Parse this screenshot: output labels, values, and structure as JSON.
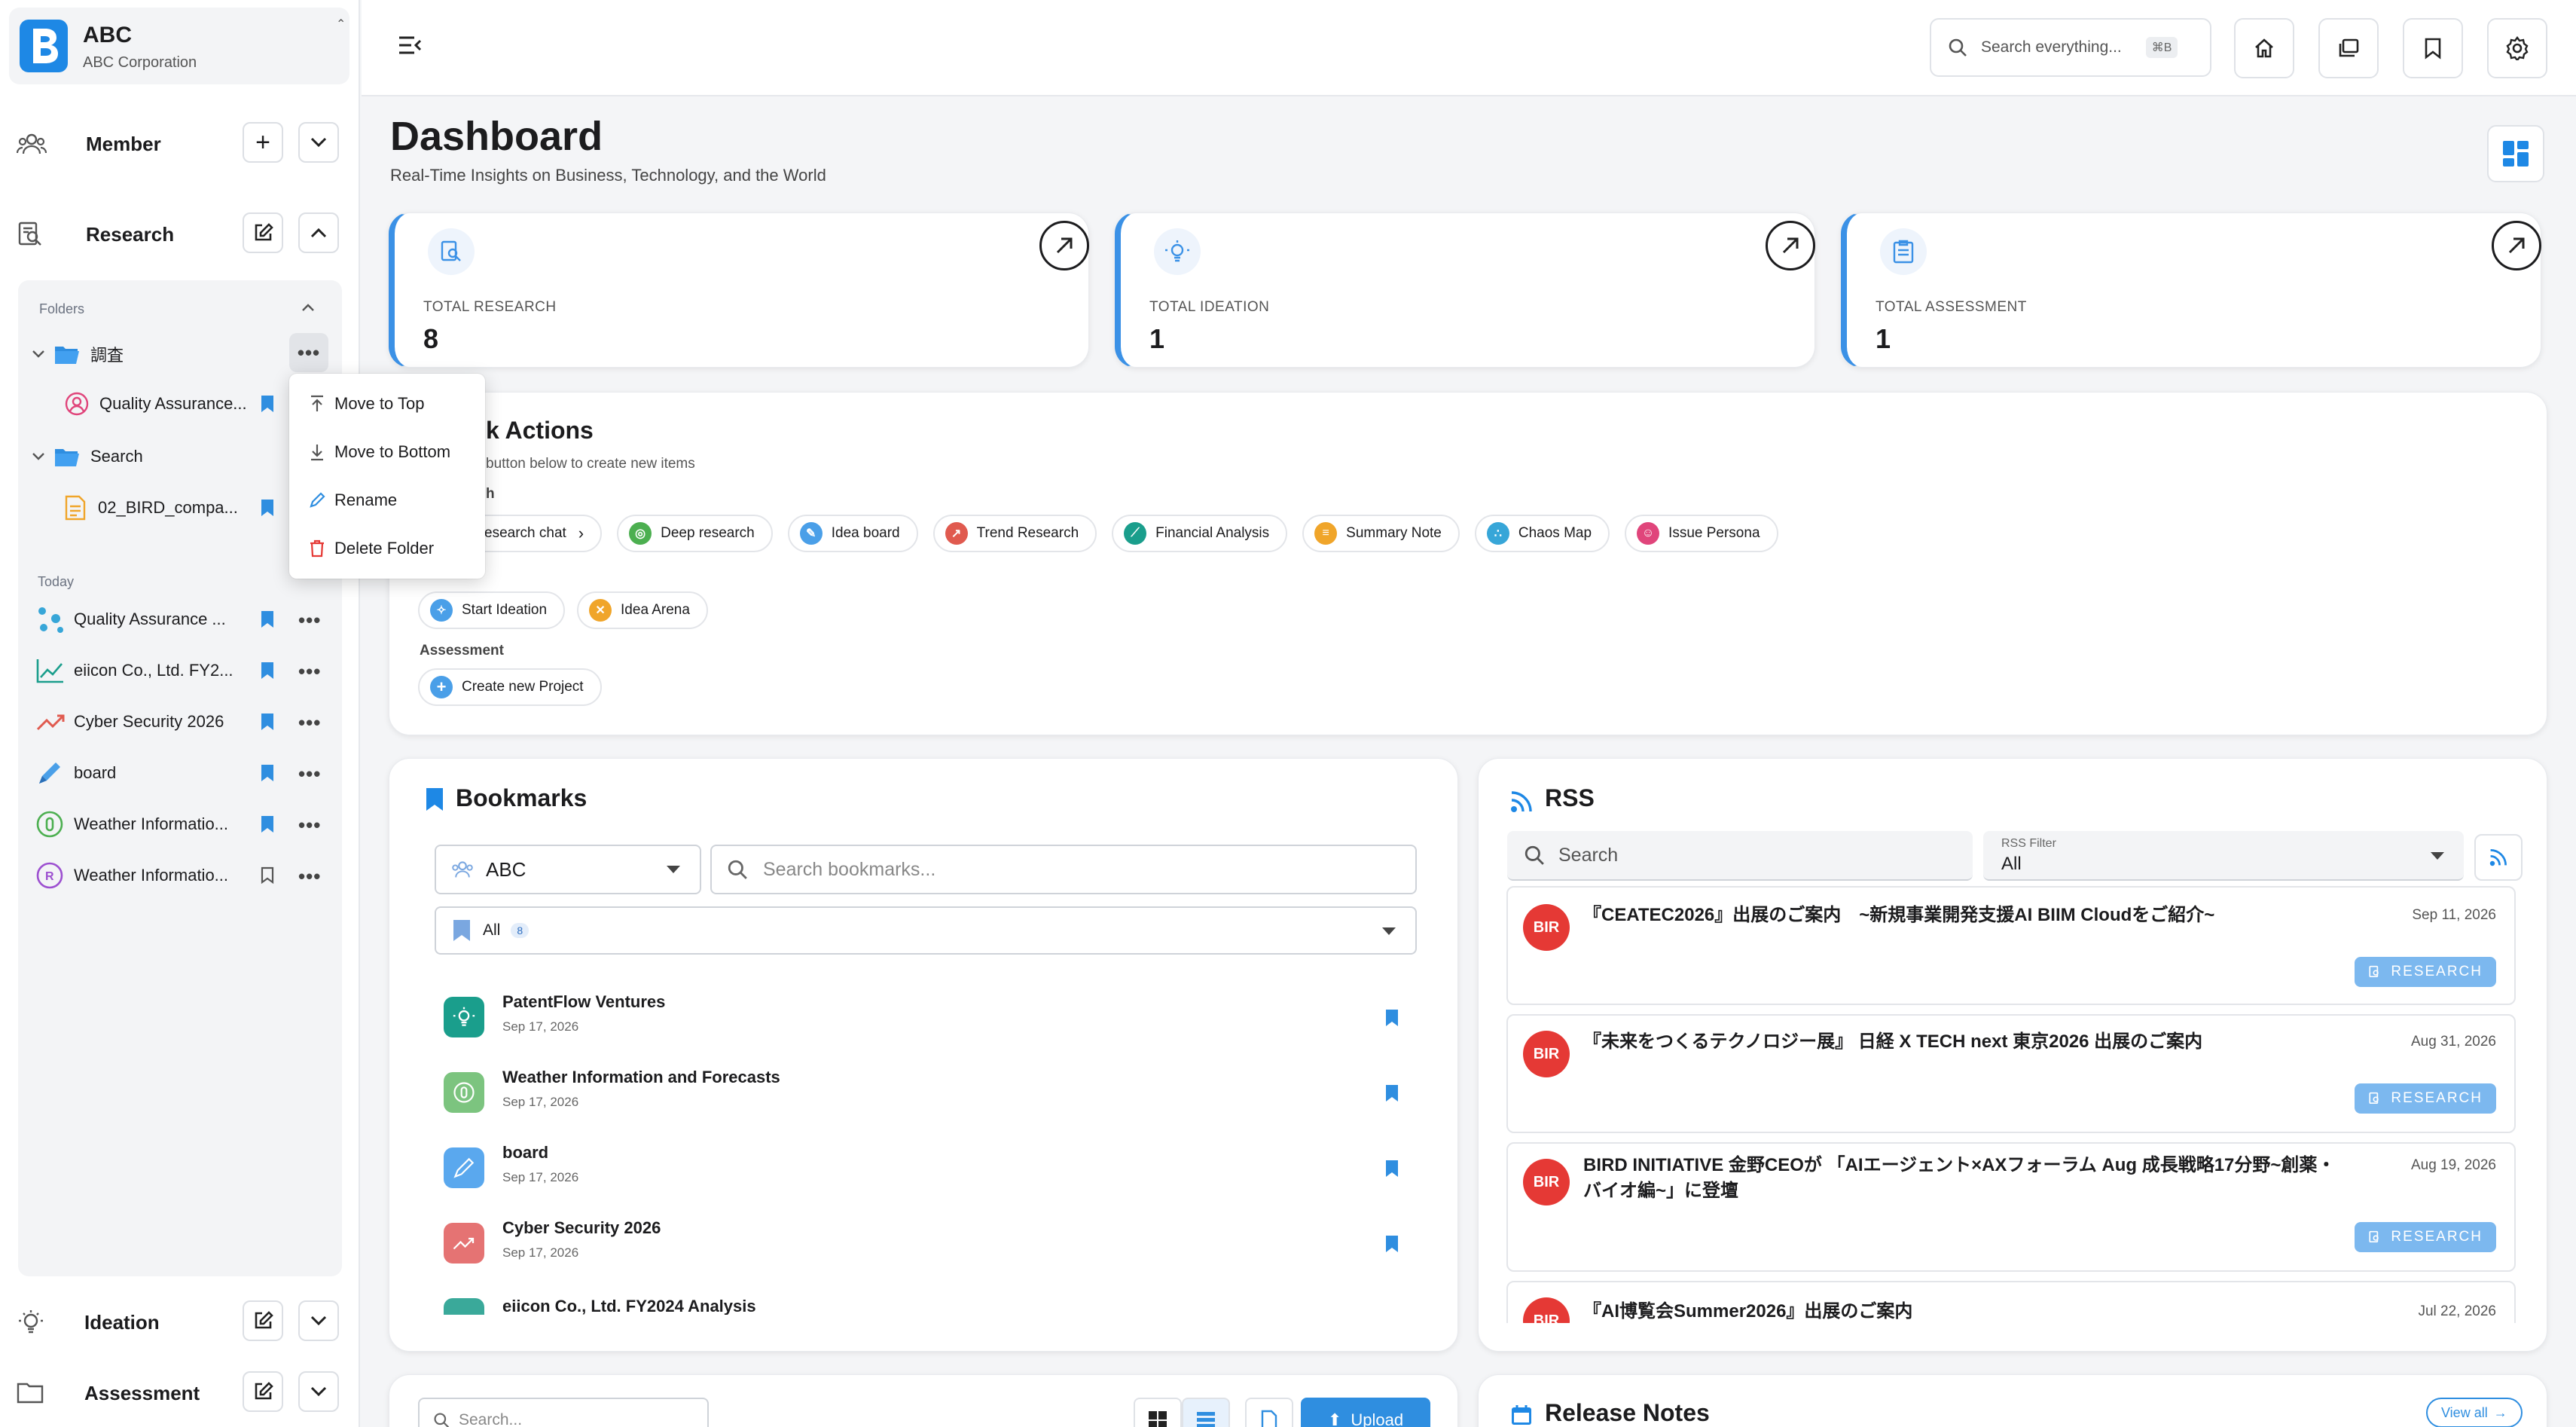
{
  "brand": {
    "name": "ABC",
    "org": "ABC Corporation",
    "logo_letter": "B"
  },
  "sidebar": {
    "member": "Member",
    "research": "Research",
    "ideation": "Ideation",
    "assessment": "Assessment",
    "folders_label": "Folders",
    "today_label": "Today",
    "folders": [
      {
        "name": "調査",
        "child": "Quality Assurance..."
      },
      {
        "name": "Search",
        "child": "02_BIRD_compa..."
      }
    ],
    "today_items": [
      "Quality Assurance ...",
      "eiicon Co., Ltd. FY2...",
      "Cyber Security 2026",
      "board",
      "Weather Informatio...",
      "Weather Informatio..."
    ]
  },
  "context_menu": [
    "Move to Top",
    "Move to Bottom",
    "Rename",
    "Delete Folder"
  ],
  "header": {
    "search_placeholder": "Search everything...",
    "shortcut": "⌘B"
  },
  "dashboard": {
    "title": "Dashboard",
    "subtitle": "Real-Time Insights on Business, Technology, and the World"
  },
  "stats": [
    {
      "label": "TOTAL RESEARCH",
      "value": "8"
    },
    {
      "label": "TOTAL IDEATION",
      "value": "1"
    },
    {
      "label": "TOTAL ASSESSMENT",
      "value": "1"
    }
  ],
  "quick": {
    "title_visible": "k Actions",
    "subtitle_visible": "button below to create new items",
    "research_label_visible": "h",
    "research_chips": [
      "esearch chat",
      "Deep research",
      "Idea board",
      "Trend Research",
      "Financial Analysis",
      "Summary Note",
      "Chaos Map",
      "Issue Persona"
    ],
    "ideation_chips": [
      "Start Ideation",
      "Idea Arena"
    ],
    "assessment_label": "Assessment",
    "assessment_chips": [
      "Create new Project"
    ]
  },
  "bookmarks": {
    "title": "Bookmarks",
    "workspace": "ABC",
    "search_placeholder": "Search bookmarks...",
    "filter": "All",
    "filter_count": "8",
    "items": [
      {
        "title": "PatentFlow Ventures",
        "date": "Sep 17, 2026"
      },
      {
        "title": "Weather Information and Forecasts",
        "date": "Sep 17, 2026"
      },
      {
        "title": "board",
        "date": "Sep 17, 2026"
      },
      {
        "title": "Cyber Security 2026",
        "date": "Sep 17, 2026"
      },
      {
        "title": "eiicon Co., Ltd. FY2024 Analysis",
        "date": ""
      }
    ]
  },
  "rss": {
    "title": "RSS",
    "search_placeholder": "Search",
    "filter_label": "RSS Filter",
    "filter_value": "All",
    "items": [
      {
        "avatar": "BIR",
        "title": "『CEATEC2026』出展のご案内　~新規事業開発支援AI BIIM Cloudをご紹介~",
        "date": "Sep 11, 2026",
        "button": "RESEARCH"
      },
      {
        "avatar": "BIR",
        "title": "『未来をつくるテクノロジー展』 日経 X TECH next 東京2026 出展のご案内",
        "date": "Aug 31, 2026",
        "button": "RESEARCH"
      },
      {
        "avatar": "BIR",
        "title": "BIRD INITIATIVE 金野CEOが 「AIエージェント×AXフォーラム Aug 成長戦略17分野~創薬・バイオ編~」に登壇",
        "date": "Aug 19, 2026",
        "button": "RESEARCH"
      },
      {
        "avatar": "BIR",
        "title": "『AI博覧会Summer2026』出展のご案内",
        "date": "Jul 22, 2026",
        "button": ""
      }
    ]
  },
  "bottom": {
    "search_placeholder": "Search...",
    "upload": "Upload",
    "release_notes": "Release Notes",
    "view_all": "View all"
  },
  "colors": {
    "accent": "#3b91e6",
    "danger": "#e53935"
  }
}
